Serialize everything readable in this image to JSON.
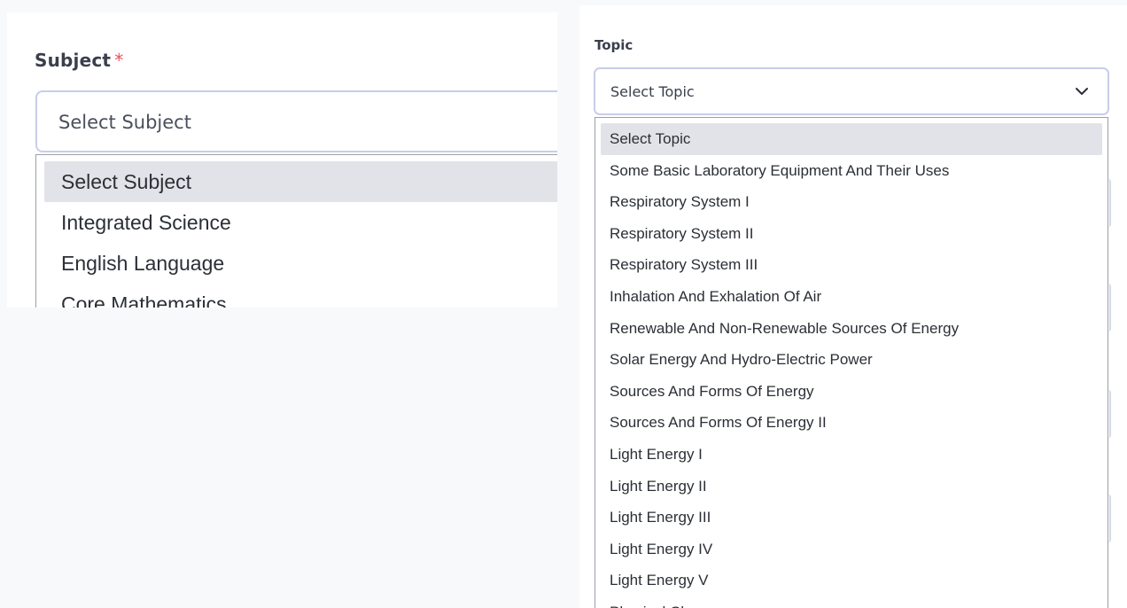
{
  "subject": {
    "label": "Subject",
    "required_mark": "*",
    "select_value": "Select Subject",
    "options": [
      "Select Subject",
      "Integrated Science",
      "English Language",
      "Core Mathematics"
    ],
    "selected_index": 0
  },
  "topic": {
    "label": "Topic",
    "select_value": "Select Topic",
    "options": [
      "Select Topic",
      "Some Basic Laboratory Equipment And Their Uses",
      "Respiratory System I",
      "Respiratory System II",
      "Respiratory System III",
      "Inhalation And Exhalation Of Air",
      "Renewable And Non-Renewable Sources Of Energy",
      "Solar Energy And Hydro-Electric Power",
      "Sources And Forms Of Energy",
      "Sources And Forms Of Energy II",
      "Light Energy I",
      "Light Energy II",
      "Light Energy III",
      "Light Energy IV",
      "Light Energy V",
      "Physical Change"
    ],
    "selected_index": 0
  },
  "icons": {
    "topic_dropdown": "chevron-down-icon"
  },
  "colors": {
    "required": "#e8505b",
    "select_border": "#c8cde8",
    "highlight": "#e1e3e8"
  }
}
